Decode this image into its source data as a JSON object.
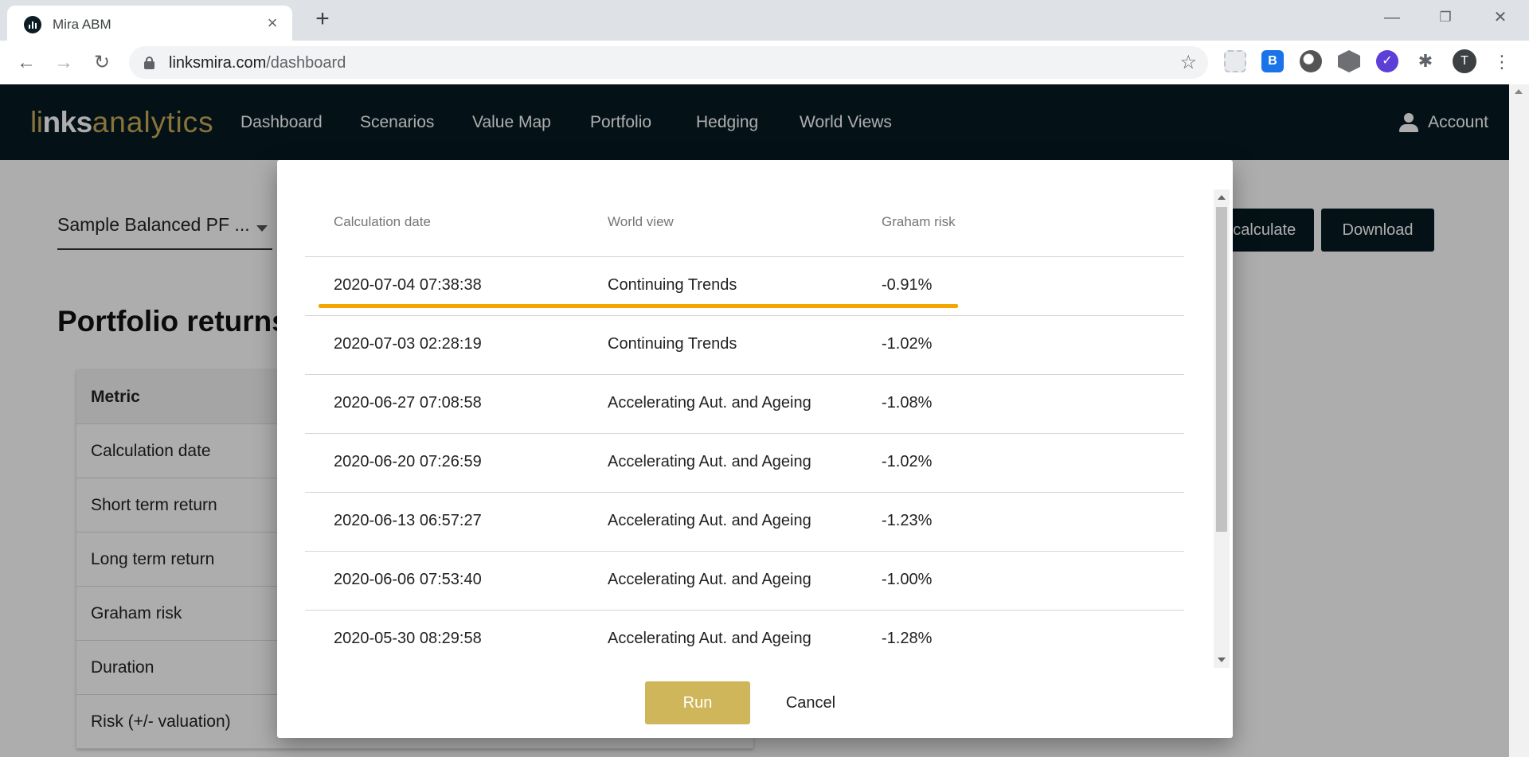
{
  "browser": {
    "tab_title": "Mira ABM",
    "url_domain": "linksmira.com",
    "url_path": "/dashboard",
    "avatar_letter": "T",
    "extension_icons": [
      "puzzle-placeholder-icon",
      "bi-extension-icon",
      "round-extension-icon",
      "cube-extension-icon",
      "check-extension-icon",
      "puzzle-icon"
    ]
  },
  "navbar": {
    "logo_part1": "li",
    "logo_part2": "nks",
    "logo_part3": "analytics",
    "items": [
      "Dashboard",
      "Scenarios",
      "Value Map",
      "Portfolio",
      "Hedging",
      "World Views"
    ],
    "account_label": "Account",
    "background": "#071b24",
    "accent": "#c9aa55"
  },
  "page": {
    "portfolio_select": "Sample Balanced PF ...",
    "title": "Portfolio returns",
    "calculate_label": "Recalculate",
    "download_label": "Download",
    "metric_header": "Metric",
    "metrics": [
      "Calculation date",
      "Short term return",
      "Long term return",
      "Graham risk",
      "Duration",
      "Risk (+/- valuation)"
    ]
  },
  "dialog": {
    "columns": [
      "Calculation date",
      "World view",
      "Graham risk"
    ],
    "rows": [
      {
        "date": "2020-07-04 07:38:38",
        "world_view": "Continuing Trends",
        "risk": "-0.91%"
      },
      {
        "date": "2020-07-03 02:28:19",
        "world_view": "Continuing Trends",
        "risk": "-1.02%"
      },
      {
        "date": "2020-06-27 07:08:58",
        "world_view": "Accelerating Aut. and Ageing",
        "risk": "-1.08%"
      },
      {
        "date": "2020-06-20 07:26:59",
        "world_view": "Accelerating Aut. and Ageing",
        "risk": "-1.02%"
      },
      {
        "date": "2020-06-13 06:57:27",
        "world_view": "Accelerating Aut. and Ageing",
        "risk": "-1.23%"
      },
      {
        "date": "2020-06-06 07:53:40",
        "world_view": "Accelerating Aut. and Ageing",
        "risk": "-1.00%"
      },
      {
        "date": "2020-05-30 08:29:58",
        "world_view": "Accelerating Aut. and Ageing",
        "risk": "-1.28%"
      }
    ],
    "run_label": "Run",
    "cancel_label": "Cancel",
    "run_color": "#cfb65a",
    "highlight_color": "#f4a700"
  }
}
